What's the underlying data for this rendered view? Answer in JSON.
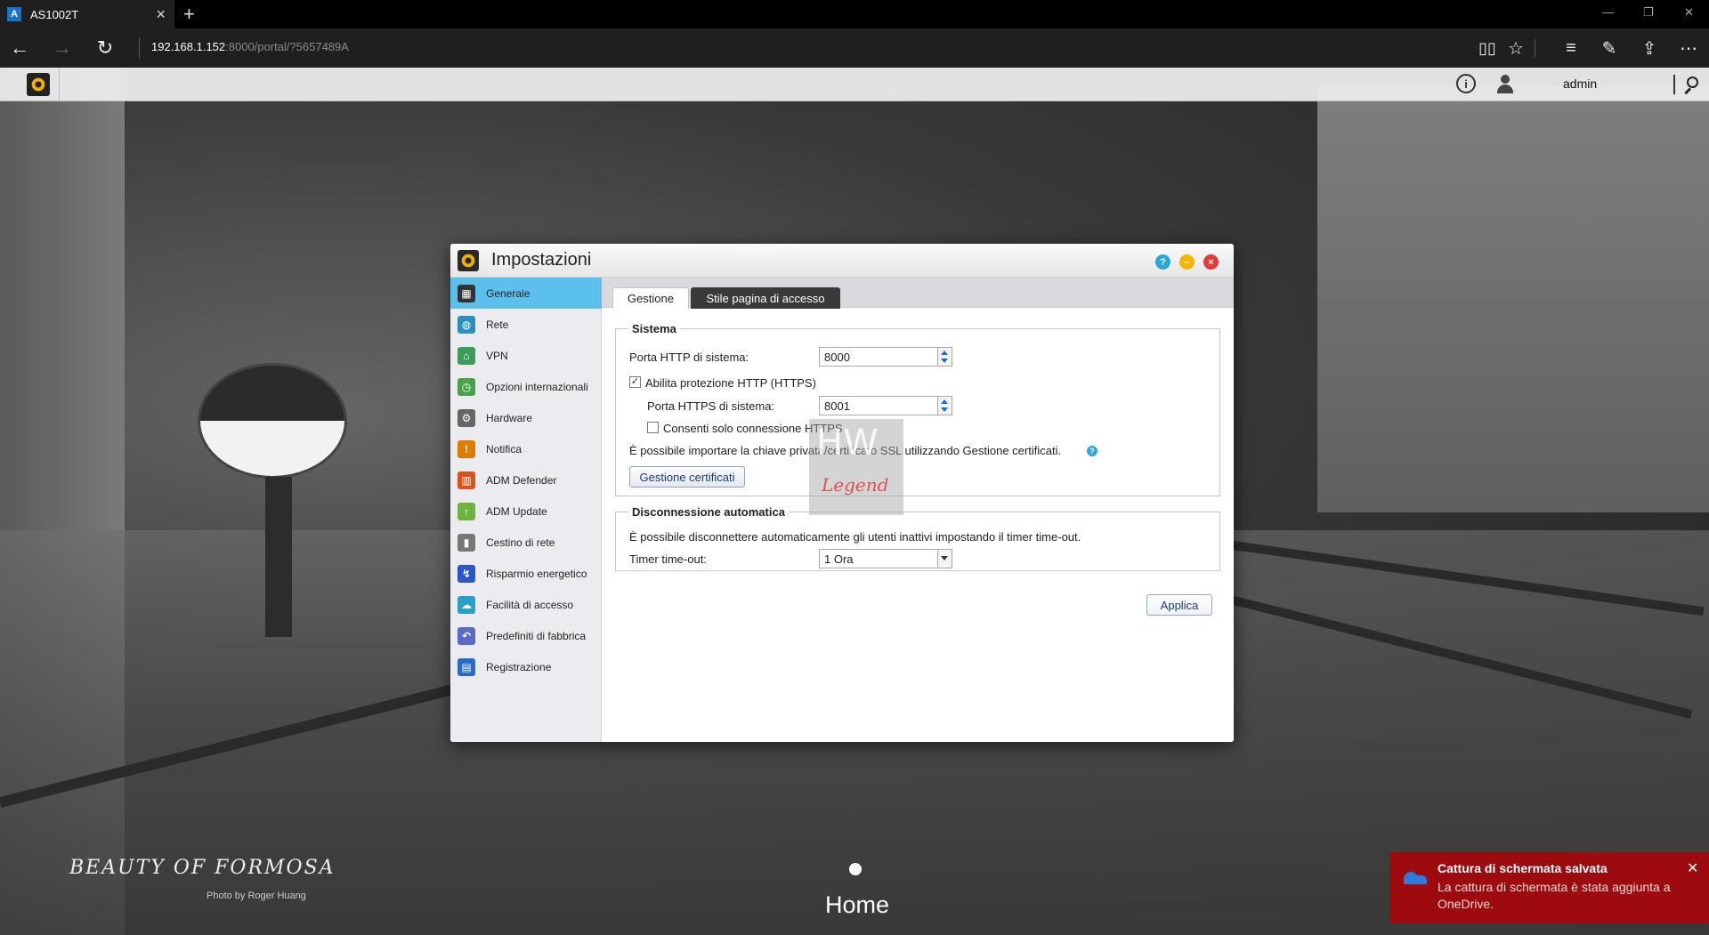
{
  "browser": {
    "tab_title": "AS1002T",
    "tab_favicon": "asustor-favicon",
    "address_host": "192.168.1.152",
    "address_rest": ":8000/portal/?5657489A",
    "icons": [
      "back-arrow-icon",
      "forward-arrow-icon",
      "refresh-icon",
      "reading-view-icon",
      "favorite-star-icon",
      "hub-icon",
      "web-note-icon",
      "share-icon",
      "more-icon"
    ]
  },
  "adm_bar": {
    "user": "admin",
    "icons": [
      "adm-logo-icon",
      "info-icon",
      "user-icon",
      "search-icon"
    ]
  },
  "settings_window": {
    "title": "Impostazioni",
    "sidebar": [
      {
        "label": "Generale",
        "icon": "building-icon",
        "color": "#333333",
        "active": true
      },
      {
        "label": "Rete",
        "icon": "globe-icon",
        "color": "#2a8fbd",
        "active": false
      },
      {
        "label": "VPN",
        "icon": "vpn-icon",
        "color": "#3a9e5a",
        "active": false
      },
      {
        "label": "Opzioni internazionali",
        "icon": "world-clock-icon",
        "color": "#4aa34a",
        "active": false
      },
      {
        "label": "Hardware",
        "icon": "hardware-icon",
        "color": "#666666",
        "active": false
      },
      {
        "label": "Notifica",
        "icon": "notification-icon",
        "color": "#e07b00",
        "active": false
      },
      {
        "label": "ADM Defender",
        "icon": "firewall-icon",
        "color": "#d8541e",
        "active": false
      },
      {
        "label": "ADM Update",
        "icon": "update-arrow-icon",
        "color": "#6cb33f",
        "active": false
      },
      {
        "label": "Cestino di rete",
        "icon": "trash-icon",
        "color": "#777777",
        "active": false
      },
      {
        "label": "Risparmio energetico",
        "icon": "energy-icon",
        "color": "#2a55c8",
        "active": false
      },
      {
        "label": "Facilità di accesso",
        "icon": "cloud-icon",
        "color": "#2a9fc8",
        "active": false
      },
      {
        "label": "Predefiniti di fabbrica",
        "icon": "reset-arrow-icon",
        "color": "#5a6ac8",
        "active": false
      },
      {
        "label": "Registrazione",
        "icon": "register-icon",
        "color": "#2a6ac8",
        "active": false
      }
    ],
    "tabs": {
      "gestione": "Gestione",
      "stile": "Stile pagina di accesso"
    },
    "sistema": {
      "legend": "Sistema",
      "http_port_label": "Porta HTTP di sistema:",
      "http_port_value": "8000",
      "https_enable_label": "Abilita protezione HTTP (HTTPS)",
      "https_enable_checked": true,
      "https_port_label": "Porta HTTPS di sistema:",
      "https_port_value": "8001",
      "https_only_label": "Consenti solo connessione HTTPS",
      "https_only_checked": false,
      "cert_info": "È possibile importare la chiave privata/certificato SSL utilizzando Gestione certificati.",
      "cert_button": "Gestione certificati"
    },
    "disconnessione": {
      "legend": "Disconnessione automatica",
      "info": "È possibile disconnettere automaticamente gli utenti inattivi impostando il timer time-out.",
      "timer_label": "Timer time-out:",
      "timer_value": "1 Ora"
    },
    "apply_button": "Applica"
  },
  "watermark": {
    "line1": "HW",
    "line2": "Legend"
  },
  "desktop": {
    "brand": "BEAUTY OF FORMOSA",
    "credit": "Photo by Roger Huang",
    "home_label": "Home"
  },
  "toast": {
    "title": "Cattura di schermata salvata",
    "body": "La cattura di schermata è stata aggiunta a OneDrive.",
    "icon": "onedrive-icon"
  }
}
